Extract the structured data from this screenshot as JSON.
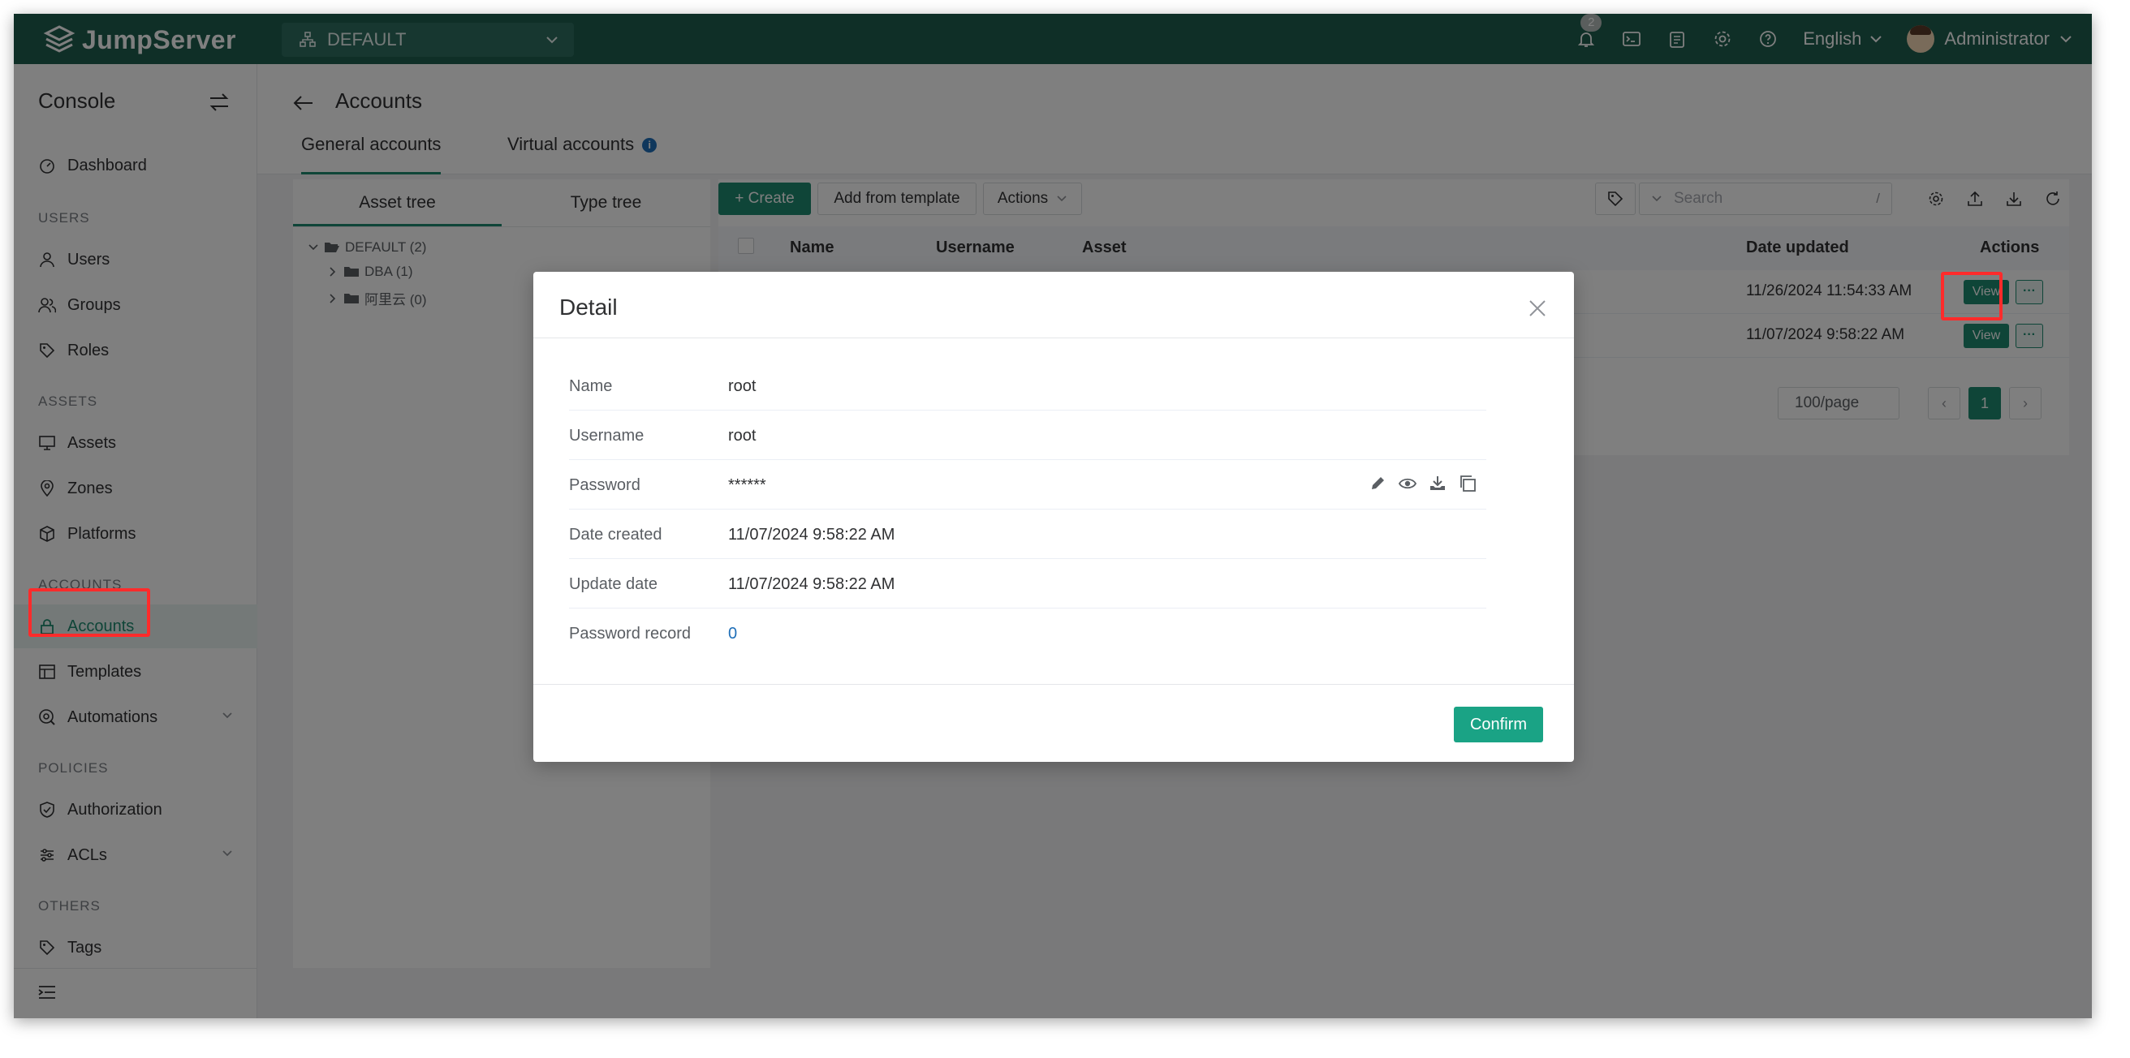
{
  "app": {
    "logo_text": "JumpServer",
    "org": "DEFAULT",
    "notification_count": "2",
    "language": "English",
    "user": "Administrator"
  },
  "sidebar": {
    "title": "Console",
    "items": [
      {
        "label": "Dashboard"
      },
      {
        "section": "USERS"
      },
      {
        "label": "Users"
      },
      {
        "label": "Groups"
      },
      {
        "label": "Roles"
      },
      {
        "section": "ASSETS"
      },
      {
        "label": "Assets"
      },
      {
        "label": "Zones"
      },
      {
        "label": "Platforms"
      },
      {
        "section": "ACCOUNTS"
      },
      {
        "label": "Accounts"
      },
      {
        "label": "Templates"
      },
      {
        "label": "Automations"
      },
      {
        "section": "POLICIES"
      },
      {
        "label": "Authorization"
      },
      {
        "label": "ACLs"
      },
      {
        "section": "OTHERS"
      },
      {
        "label": "Tags"
      }
    ]
  },
  "page": {
    "title": "Accounts",
    "tabs": [
      "General accounts",
      "Virtual accounts"
    ]
  },
  "tree": {
    "tabs": [
      "Asset tree",
      "Type tree"
    ],
    "nodes": [
      "DEFAULT (2)",
      "DBA (1)",
      "阿里云 (0)"
    ]
  },
  "toolbar": {
    "create": "+ Create",
    "add_template": "Add from template",
    "actions": "Actions",
    "search_placeholder": "Search",
    "search_shortcut": "/"
  },
  "table": {
    "columns": [
      "Name",
      "Username",
      "Asset",
      "Date updated",
      "Actions"
    ],
    "rows": [
      {
        "date_updated": "11/26/2024 11:54:33 AM",
        "view": "View",
        "more": "···"
      },
      {
        "date_updated": "11/07/2024 9:58:22 AM",
        "view": "View",
        "more": "···"
      }
    ],
    "page_size": "100/page",
    "current_page": "1"
  },
  "modal": {
    "title": "Detail",
    "rows": [
      {
        "label": "Name",
        "value": "root"
      },
      {
        "label": "Username",
        "value": "root"
      },
      {
        "label": "Password",
        "value": "******"
      },
      {
        "label": "Date created",
        "value": "11/07/2024 9:58:22 AM"
      },
      {
        "label": "Update date",
        "value": "11/07/2024 9:58:22 AM"
      },
      {
        "label": "Password record",
        "value": "0"
      }
    ],
    "confirm": "Confirm"
  },
  "colors": {
    "brand": "#1f5e4f",
    "accent": "#1f8a70",
    "confirm": "#1aa385",
    "highlight": "#ff2b2b"
  }
}
